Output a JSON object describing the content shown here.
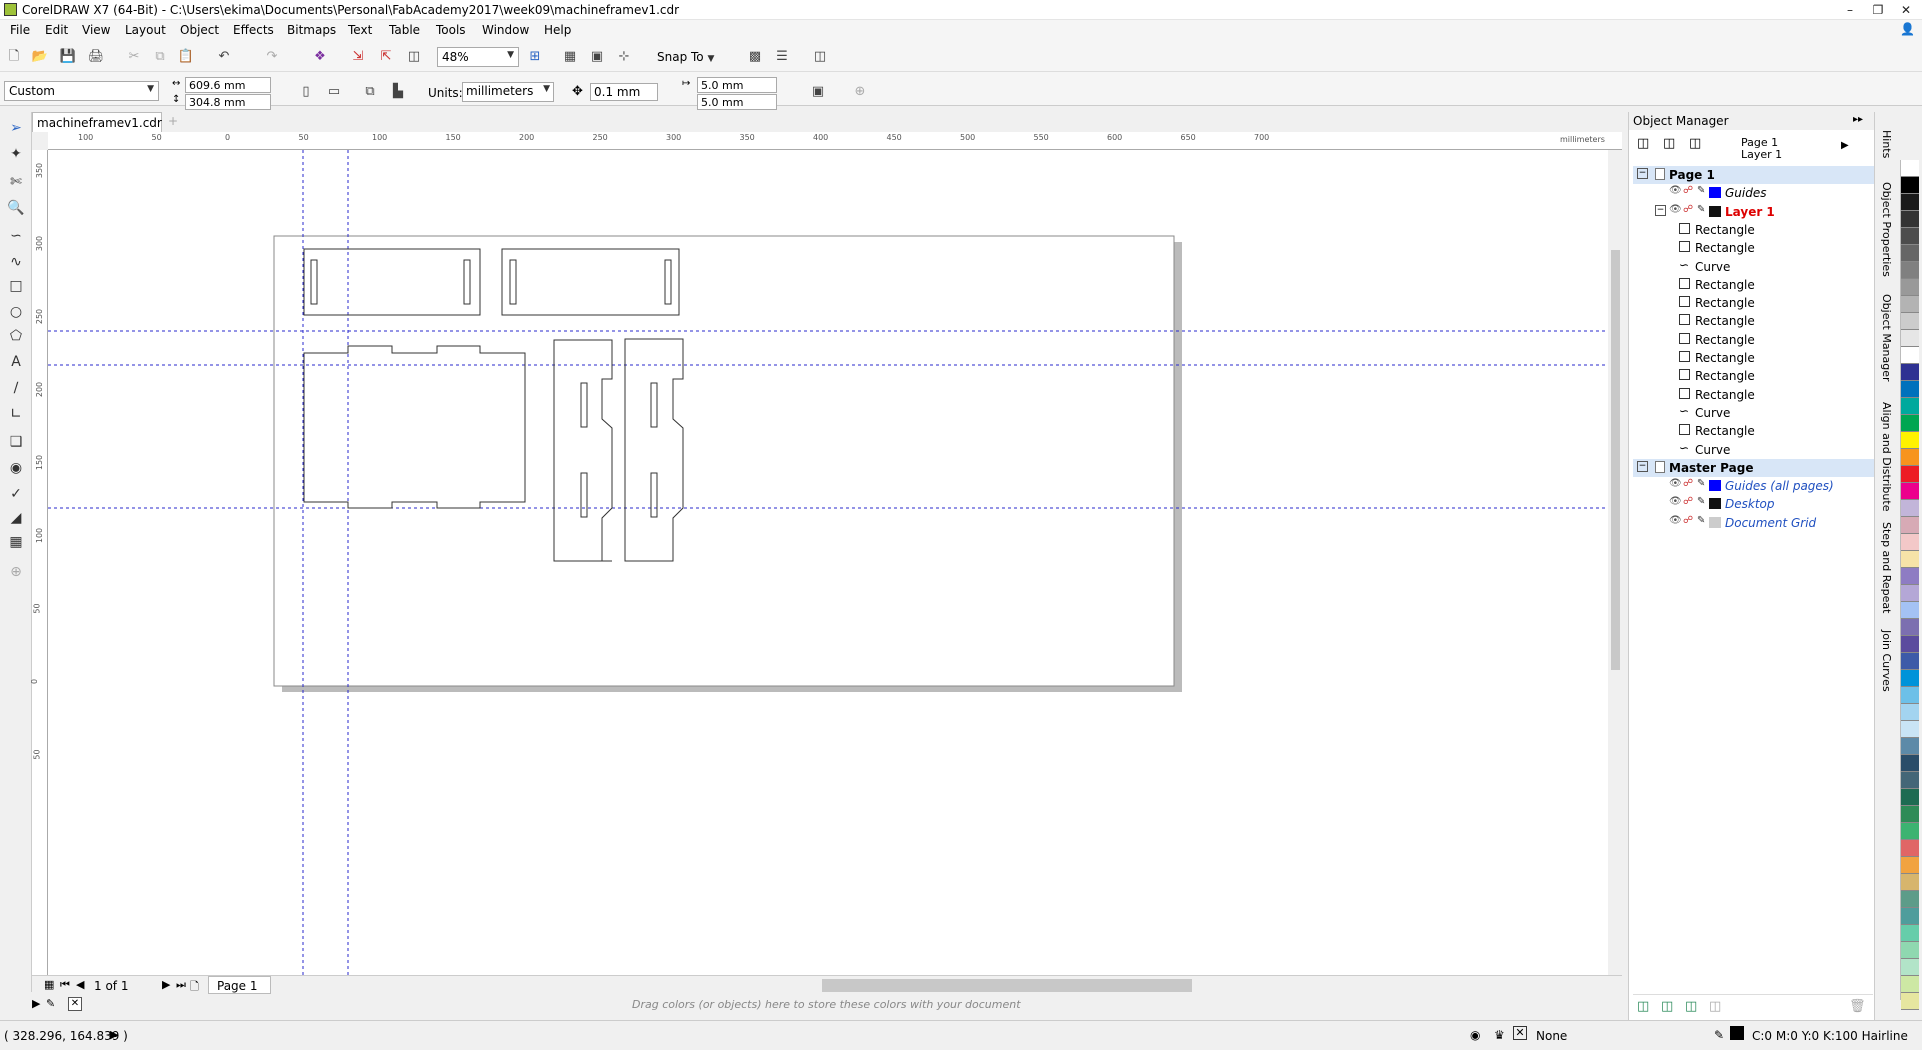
{
  "window": {
    "title": "CorelDRAW X7 (64-Bit) - C:\\Users\\ekima\\Documents\\Personal\\FabAcademy2017\\week09\\machineframev1.cdr"
  },
  "menu": [
    "File",
    "Edit",
    "View",
    "Layout",
    "Object",
    "Effects",
    "Bitmaps",
    "Text",
    "Table",
    "Tools",
    "Window",
    "Help"
  ],
  "toolbar": {
    "zoom": "48%",
    "snap_to": "Snap To"
  },
  "propbar": {
    "preset": "Custom",
    "width": "609.6 mm",
    "height": "304.8 mm",
    "units_label": "Units:",
    "units": "millimeters",
    "nudge": "0.1 mm",
    "dup_x": "5.0 mm",
    "dup_y": "5.0 mm"
  },
  "document": {
    "tab": "machineframev1.cdr"
  },
  "ruler": {
    "h_ticks": [
      "100",
      "50",
      "0",
      "50",
      "100",
      "150",
      "200",
      "250",
      "300",
      "350",
      "400",
      "450",
      "500",
      "550",
      "600",
      "650",
      "700"
    ],
    "h_unit": "millimeters",
    "v_ticks": [
      "350",
      "300",
      "250",
      "200",
      "150",
      "100",
      "50",
      "0",
      "50"
    ],
    "v_unit": "millimeters"
  },
  "pagenav": {
    "count": "1 of 1",
    "page_tab": "Page 1"
  },
  "colorbar": {
    "hint": "Drag colors (or objects) here to store these colors with your document"
  },
  "status": {
    "coords": "( 328.296, 164.839 )",
    "fill": "None",
    "outline": "C:0 M:0 Y:0 K:100  Hairline"
  },
  "object_manager": {
    "title": "Object Manager",
    "current_page": "Page 1",
    "current_layer": "Layer 1",
    "rows": [
      {
        "label": "Page 1",
        "kind": "page"
      },
      {
        "label": "Guides",
        "kind": "layer-guides"
      },
      {
        "label": "Layer 1",
        "kind": "layer-active"
      },
      {
        "label": "Rectangle",
        "kind": "rect"
      },
      {
        "label": "Rectangle",
        "kind": "rect"
      },
      {
        "label": "Curve",
        "kind": "curve"
      },
      {
        "label": "Rectangle",
        "kind": "rect"
      },
      {
        "label": "Rectangle",
        "kind": "rect"
      },
      {
        "label": "Rectangle",
        "kind": "rect"
      },
      {
        "label": "Rectangle",
        "kind": "rect"
      },
      {
        "label": "Rectangle",
        "kind": "rect"
      },
      {
        "label": "Rectangle",
        "kind": "rect"
      },
      {
        "label": "Rectangle",
        "kind": "rect"
      },
      {
        "label": "Curve",
        "kind": "curve"
      },
      {
        "label": "Rectangle",
        "kind": "rect"
      },
      {
        "label": "Curve",
        "kind": "curve"
      },
      {
        "label": "Master Page",
        "kind": "page"
      },
      {
        "label": "Guides (all pages)",
        "kind": "master"
      },
      {
        "label": "Desktop",
        "kind": "master"
      },
      {
        "label": "Document Grid",
        "kind": "master"
      }
    ]
  },
  "dockers": [
    "Hints",
    "Object Properties",
    "Object Manager",
    "Align and Distribute",
    "Step and Repeat",
    "Join Curves"
  ],
  "palette": [
    "#ffffff",
    "#000000",
    "#1a1a1a",
    "#333333",
    "#4d4d4d",
    "#666666",
    "#808080",
    "#999999",
    "#b3b3b3",
    "#cccccc",
    "#e6e6e6",
    "#ffffff",
    "#2e3192",
    "#0071bc",
    "#00a99d",
    "#00a651",
    "#fff200",
    "#f7941d",
    "#ed1c24",
    "#ec008c",
    "#c2b5d9",
    "#d7aab5",
    "#f3c8c8",
    "#f6e3a8",
    "#8e7cc3",
    "#b4a7d6",
    "#a4c2f4",
    "#7c6fb0",
    "#5b4b9e",
    "#3d5aa8",
    "#0093d9",
    "#6dc0e8",
    "#a3d4f0",
    "#c9e4f5",
    "#5d8aa8",
    "#2a4d69",
    "#446677",
    "#1e6b52",
    "#2e8b57",
    "#3cb371",
    "#e06666",
    "#f1a340",
    "#d7b56d",
    "#5d9c89",
    "#4f9d9c",
    "#66cdaa",
    "#8fd8b0",
    "#b2e4c8",
    "#cde8a4",
    "#e6e6a0"
  ]
}
